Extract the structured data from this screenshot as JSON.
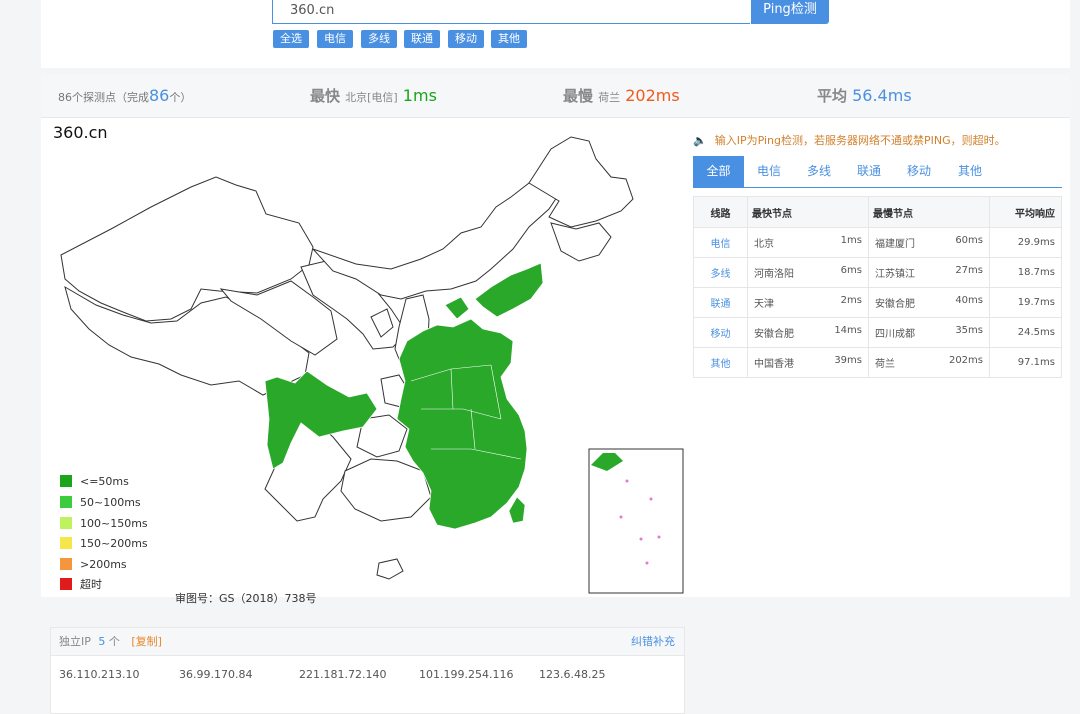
{
  "search": {
    "value": "360.cn",
    "button": "Ping检测"
  },
  "filters": [
    "全选",
    "电信",
    "多线",
    "联通",
    "移动",
    "其他"
  ],
  "stats": {
    "nodes_prefix": "86个探测点（完成",
    "nodes_done": "86",
    "nodes_suffix": "个）",
    "fastest": {
      "title": "最快",
      "node": "北京[电信]",
      "value": "1ms"
    },
    "slowest": {
      "title": "最慢",
      "node": "荷兰",
      "value": "202ms"
    },
    "average": {
      "title": "平均",
      "value": "56.4ms"
    }
  },
  "map": {
    "title": "360.cn",
    "approval": "审图号：GS（2018）738号",
    "legend": [
      {
        "label": "<=50ms",
        "color": "#1aa51a"
      },
      {
        "label": "50~100ms",
        "color": "#3dcc3d"
      },
      {
        "label": "100~150ms",
        "color": "#bff25f"
      },
      {
        "label": "150~200ms",
        "color": "#f5e64c"
      },
      {
        "label": ">200ms",
        "color": "#f5963c"
      },
      {
        "label": "超时",
        "color": "#e01b1b"
      }
    ]
  },
  "notice": "输入IP为Ping检测，若服务器网络不通或禁PING，则超时。",
  "tabs": [
    "全部",
    "电信",
    "多线",
    "联通",
    "移动",
    "其他"
  ],
  "table": {
    "headers": {
      "line": "线路",
      "fastest": "最快节点",
      "slowest": "最慢节点",
      "avg": "平均响应"
    },
    "rows": [
      {
        "line": "电信",
        "fast_node": "北京",
        "fast_ms": "1ms",
        "slow_node": "福建厦门",
        "slow_ms": "60ms",
        "avg": "29.9ms"
      },
      {
        "line": "多线",
        "fast_node": "河南洛阳",
        "fast_ms": "6ms",
        "slow_node": "江苏镇江",
        "slow_ms": "27ms",
        "avg": "18.7ms"
      },
      {
        "line": "联通",
        "fast_node": "天津",
        "fast_ms": "2ms",
        "slow_node": "安徽合肥",
        "slow_ms": "40ms",
        "avg": "19.7ms"
      },
      {
        "line": "移动",
        "fast_node": "安徽合肥",
        "fast_ms": "14ms",
        "slow_node": "四川成都",
        "slow_ms": "35ms",
        "avg": "24.5ms"
      },
      {
        "line": "其他",
        "fast_node": "中国香港",
        "fast_ms": "39ms",
        "slow_node": "荷兰",
        "slow_ms": "202ms",
        "avg": "97.1ms"
      }
    ]
  },
  "ips": {
    "label": "独立IP",
    "count": "5",
    "unit": "个",
    "copy": "[复制]",
    "report": "纠错补充",
    "list": [
      "36.110.213.10",
      "36.99.170.84",
      "221.181.72.140",
      "101.199.254.116",
      "123.6.48.25"
    ]
  },
  "colors": {
    "accent": "#4a90e2",
    "fast": "#1aa51a",
    "slow": "#f05a1a",
    "province_ok": "#2aa82a",
    "province_none": "#ffffff"
  }
}
